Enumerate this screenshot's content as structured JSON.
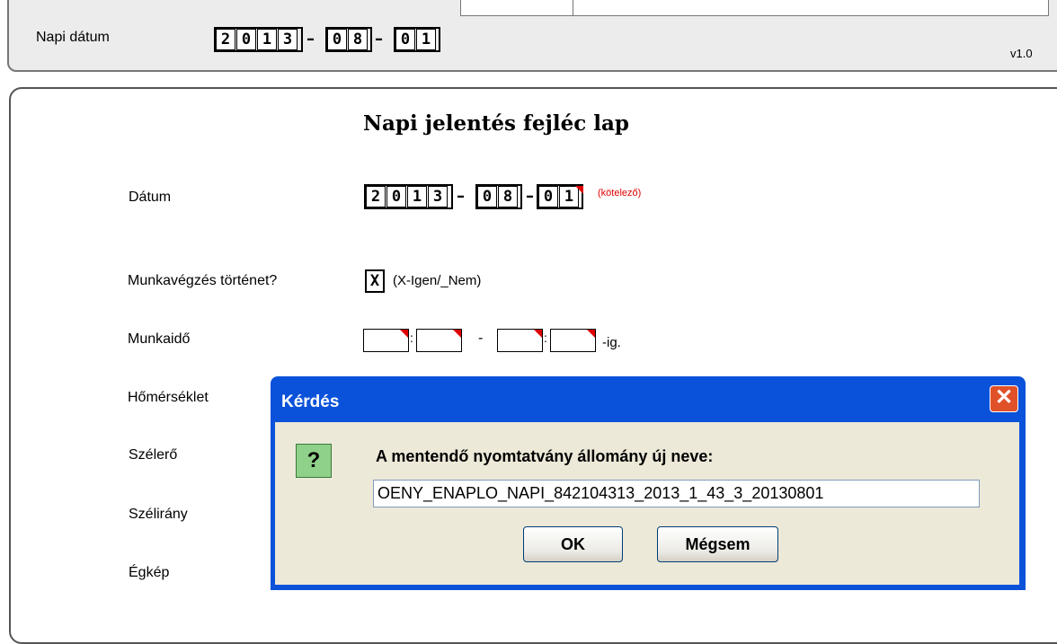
{
  "top": {
    "date_label": "Napi dátum",
    "date_digits": [
      "2",
      "0",
      "1",
      "3",
      "8",
      "0",
      "1"
    ],
    "date_parts": {
      "y": [
        "2",
        "0",
        "1",
        "3"
      ],
      "m": [
        "0",
        "8"
      ],
      "d": [
        "0",
        "1"
      ]
    },
    "version": "v1.0"
  },
  "form": {
    "title": "Napi jelentés fejléc lap",
    "date_label": "Dátum",
    "date": {
      "y": [
        "2",
        "0",
        "1",
        "3"
      ],
      "m": [
        "0",
        "8"
      ],
      "d": [
        "0",
        "1"
      ]
    },
    "required_note": "(kötelező)",
    "work_label": "Munkavégzés történet?",
    "work_value": "X",
    "work_hint": "(X-Igen/_Nem)",
    "hours_label": "Munkaidő",
    "hours_suffix": "-ig.",
    "temp_label": "Hőmérséklet",
    "wind_label": "Szélerő",
    "wind_dir_label": "Szélirány",
    "sky_label": "Égkép",
    "dash": "–",
    "colon": ":",
    "range_dash": "-"
  },
  "dialog": {
    "title": "Kérdés",
    "close_glyph": "✕",
    "icon_glyph": "?",
    "question": "A mentendő nyomtatvány állomány új neve:",
    "filename": "OENY_ENAPLO_NAPI_842104313_2013_1_43_3_20130801",
    "ok_label": "OK",
    "cancel_label": "Mégsem"
  },
  "colors": {
    "dialog_frame": "#0a52d9",
    "required": "#e00000",
    "close": "#e0512a"
  }
}
